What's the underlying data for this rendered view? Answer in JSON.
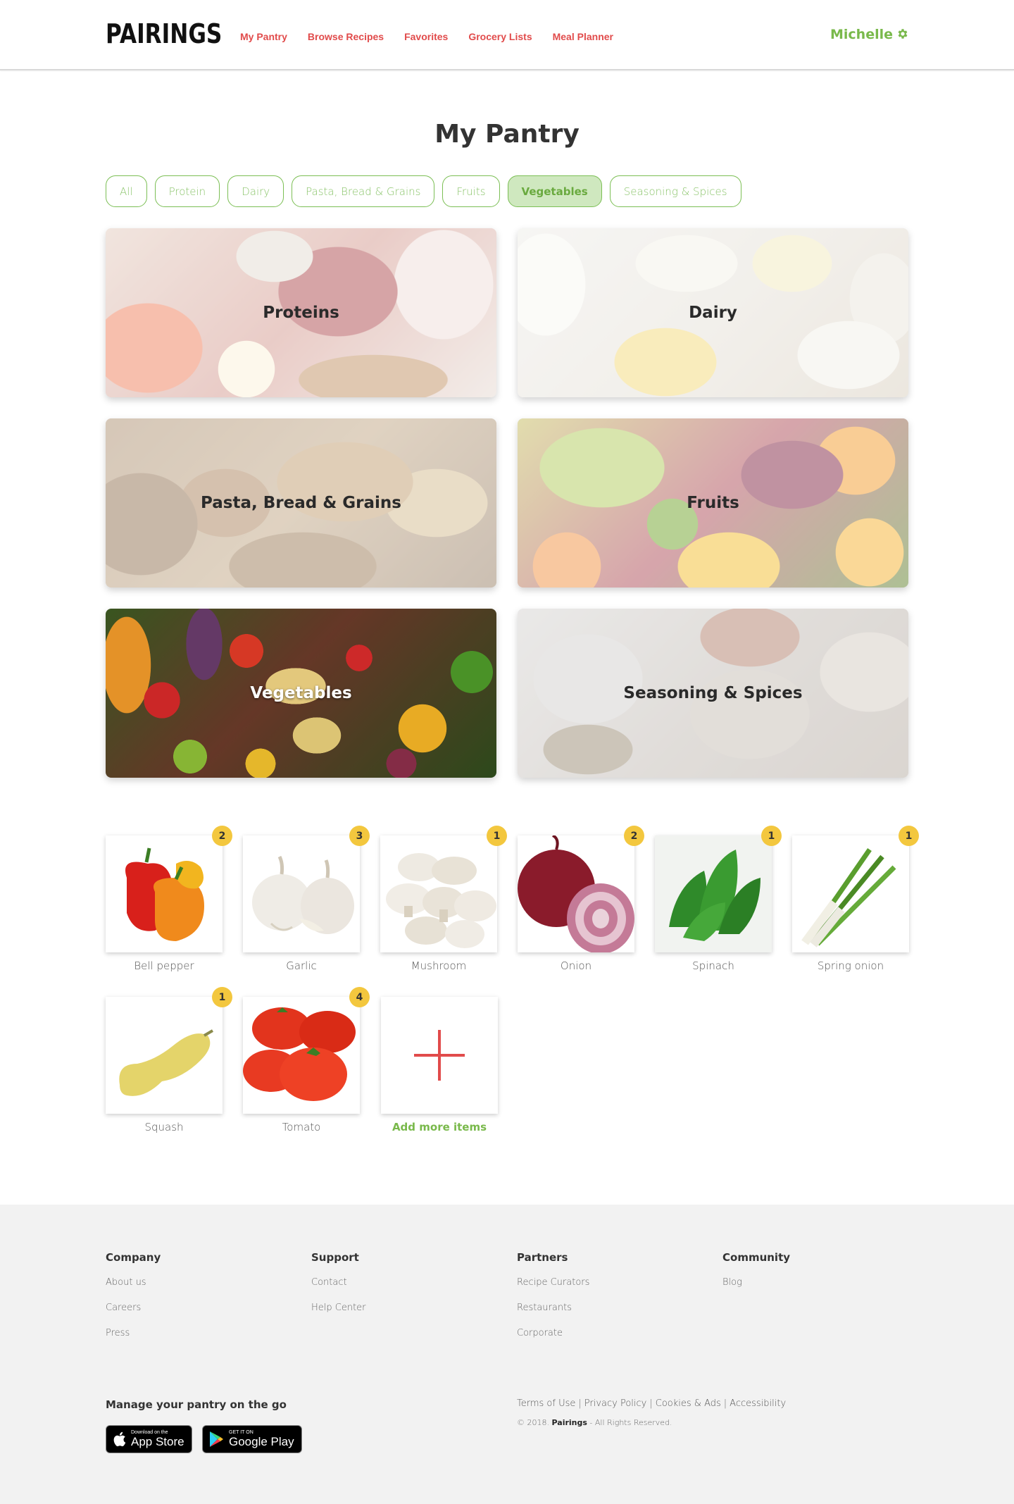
{
  "header": {
    "logo": "PAIRINGS",
    "nav": [
      "My Pantry",
      "Browse Recipes",
      "Favorites",
      "Grocery Lists",
      "Meal Planner"
    ],
    "user_name": "Michelle",
    "settings_icon": "gear-icon"
  },
  "page_title": "My Pantry",
  "filters": {
    "items": [
      "All",
      "Protein",
      "Dairy",
      "Pasta, Bread & Grains",
      "Fruits",
      "Vegetables",
      "Seasoning & Spices"
    ],
    "active": "Vegetables"
  },
  "categories": [
    {
      "label": "Proteins"
    },
    {
      "label": "Dairy"
    },
    {
      "label": "Pasta, Bread & Grains"
    },
    {
      "label": "Fruits"
    },
    {
      "label": "Vegetables"
    },
    {
      "label": "Seasoning & Spices"
    }
  ],
  "items": [
    {
      "name": "Bell pepper",
      "count": "2"
    },
    {
      "name": "Garlic",
      "count": "3"
    },
    {
      "name": "Mushroom",
      "count": "1"
    },
    {
      "name": "Onion",
      "count": "2"
    },
    {
      "name": "Spinach",
      "count": "1"
    },
    {
      "name": "Spring onion",
      "count": "1"
    },
    {
      "name": "Squash",
      "count": "1"
    },
    {
      "name": "Tomato",
      "count": "4"
    }
  ],
  "add_item_label": "Add more items",
  "footer": {
    "columns": [
      {
        "title": "Company",
        "links": [
          "About us",
          "Careers",
          "Press"
        ]
      },
      {
        "title": "Support",
        "links": [
          "Contact",
          "Help Center"
        ]
      },
      {
        "title": "Partners",
        "links": [
          "Recipe Curators",
          "Restaurants",
          "Corporate"
        ]
      },
      {
        "title": "Community",
        "links": [
          "Blog"
        ]
      }
    ],
    "app_title": "Manage your pantry on the go",
    "app_store": {
      "small": "Download on the",
      "large": "App Store"
    },
    "google_play": {
      "small": "GET IT ON",
      "large": "Google Play"
    },
    "legal_links": [
      "Terms of Use",
      "Privacy Policy",
      "Cookies & Ads",
      "Accessibility"
    ],
    "copyright_prefix": "© 2018.",
    "copyright_brand": "Pairings",
    "copyright_suffix": "- All Rights Reserved."
  },
  "colors": {
    "accent_red": "#e14b4b",
    "accent_green": "#79b94b",
    "badge_yellow": "#f3c73e"
  }
}
